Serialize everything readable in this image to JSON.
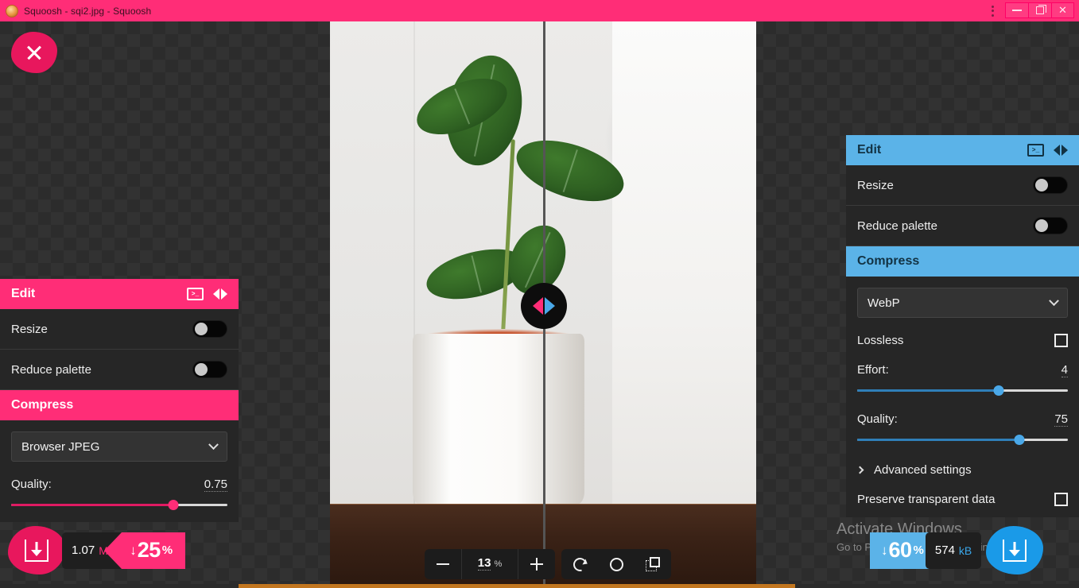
{
  "window": {
    "title": "Squoosh - sqi2.jpg - Squoosh",
    "favicon": "squoosh-favicon-icon",
    "kebab": "more-options-icon",
    "minimize": "minimize-icon",
    "restore": "restore-icon",
    "close": "close-icon"
  },
  "close_button": {
    "name": "close-image-button",
    "glyph": "×"
  },
  "split_handle": {
    "left_arrow": "pink-left-arrow",
    "right_arrow": "blue-right-arrow"
  },
  "left_panel": {
    "edit": {
      "title": "Edit",
      "terminal_icon": ">_",
      "swap_icon": "swap-sides-icon",
      "rows": [
        {
          "label": "Resize",
          "toggle": "off"
        },
        {
          "label": "Reduce palette",
          "toggle": "off"
        }
      ]
    },
    "compress": {
      "title": "Compress",
      "codec": "Browser JPEG",
      "quality_label": "Quality:",
      "quality_value": "0.75",
      "quality_percent": 75
    }
  },
  "right_panel": {
    "edit": {
      "title": "Edit",
      "terminal_icon": ">_",
      "swap_icon": "swap-sides-icon",
      "rows": [
        {
          "label": "Resize",
          "toggle": "off"
        },
        {
          "label": "Reduce palette",
          "toggle": "off"
        }
      ]
    },
    "compress": {
      "title": "Compress",
      "codec": "WebP",
      "lossless_label": "Lossless",
      "lossless_checked": false,
      "effort_label": "Effort:",
      "effort_value": "4",
      "effort_percent": 62,
      "quality_label": "Quality:",
      "quality_value": "75",
      "quality_percent": 75,
      "advanced_label": "Advanced settings",
      "preserve_label": "Preserve transparent data",
      "preserve_checked": false
    }
  },
  "zoom_toolbar": {
    "minus": "zoom-out-icon",
    "value": "13",
    "unit": "%",
    "plus": "zoom-in-icon",
    "rotate": "rotate-icon",
    "background": "toggle-background-icon",
    "layers": "toggle-original-icon"
  },
  "results": {
    "left": {
      "download": "download-icon",
      "size": "1.07",
      "unit": "MB",
      "delta_arrow": "↓",
      "delta_value": "25",
      "delta_unit": "%"
    },
    "right": {
      "download": "download-icon",
      "size": "574",
      "unit": "kB",
      "delta_arrow": "↓",
      "delta_value": "60",
      "delta_unit": "%"
    }
  },
  "watermark": {
    "line1": "Activate Windows",
    "line2": "Go to PC settings to activate Windows."
  },
  "colors": {
    "pink": "#ff2d77",
    "blue": "#5bb3e8",
    "panel_bg": "#262626",
    "workspace_bg": "#2c2c2c"
  }
}
